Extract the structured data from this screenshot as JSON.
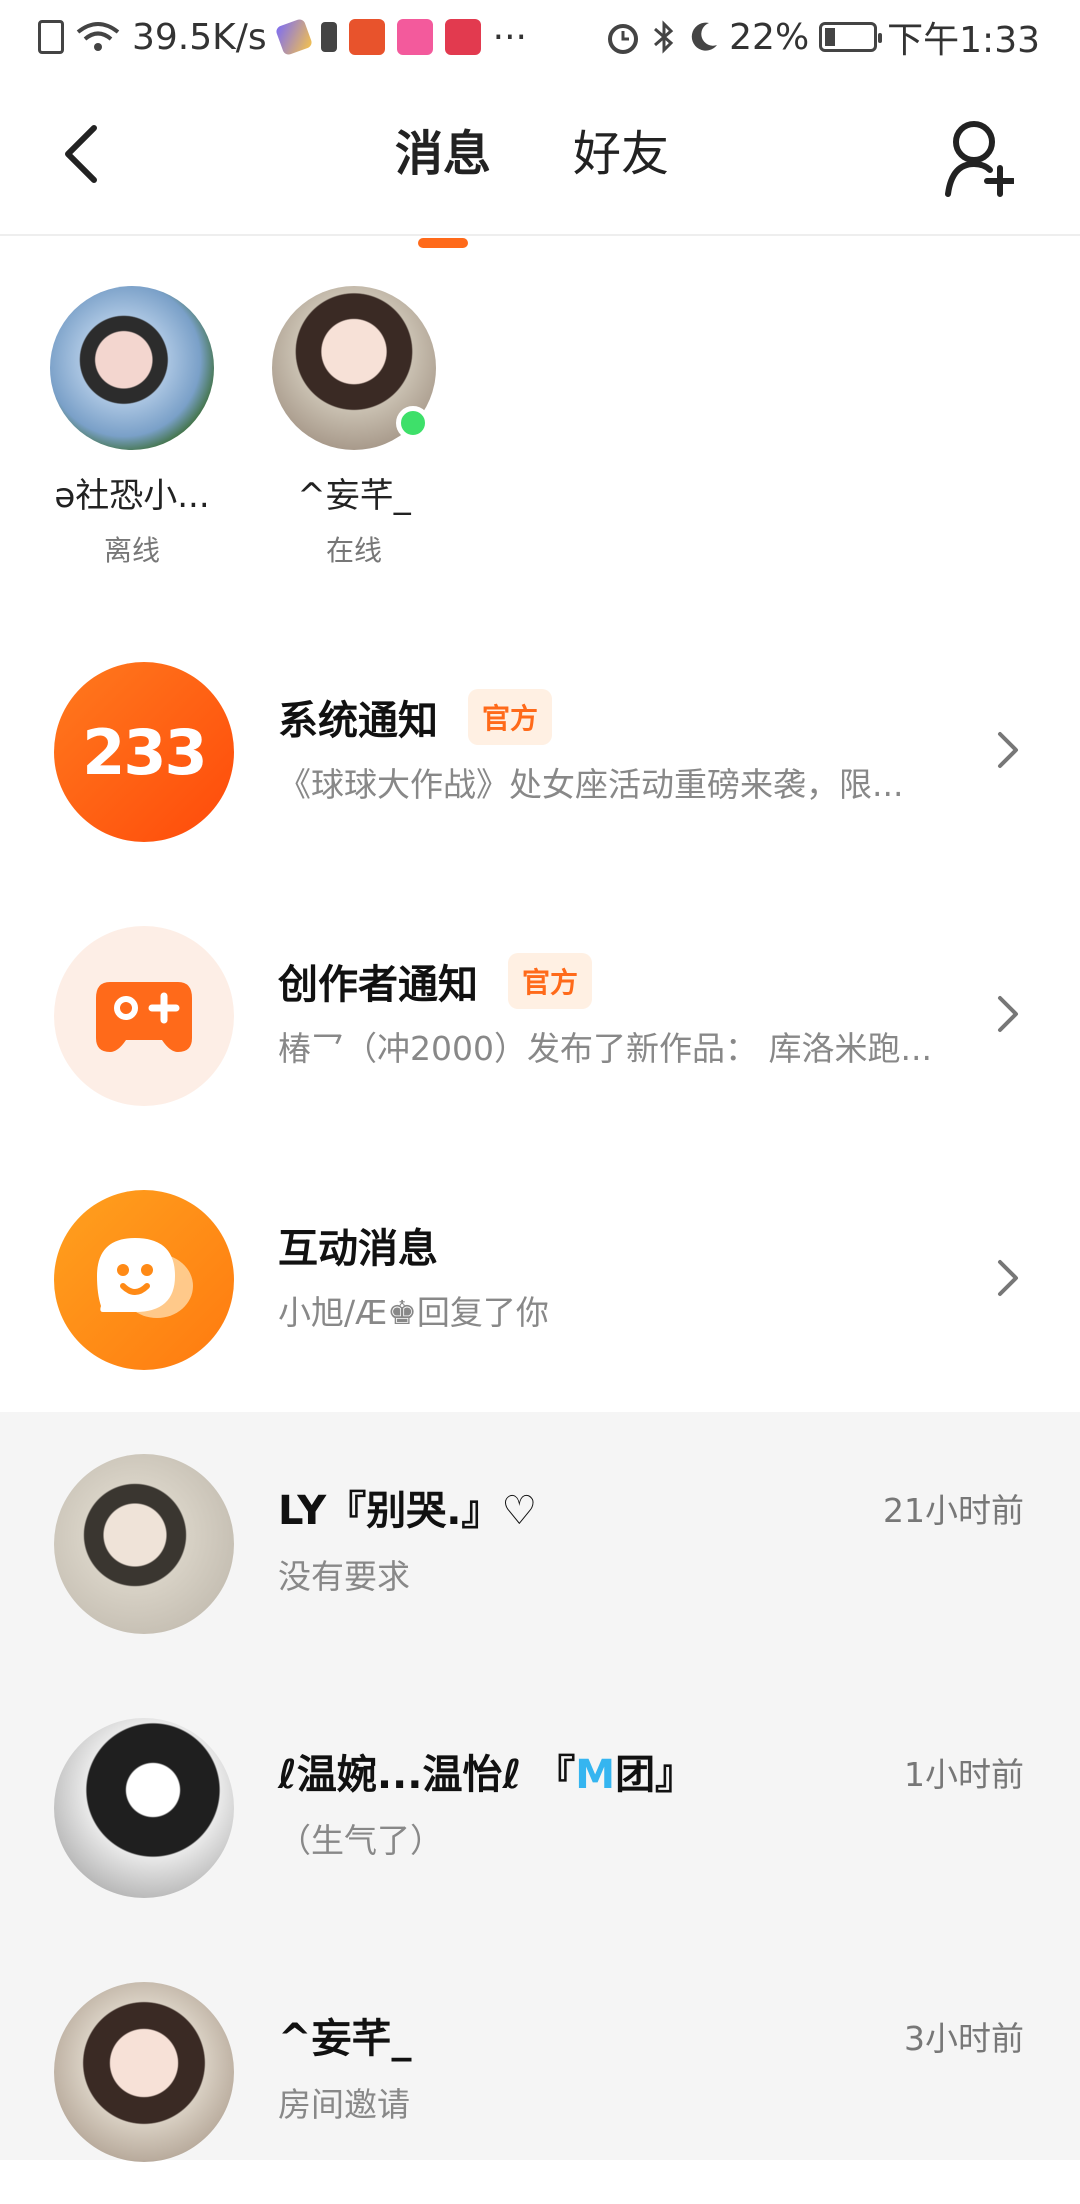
{
  "status_bar": {
    "net_speed": "39.5K/s",
    "battery": "22%",
    "time": "下午1:33",
    "more": "···"
  },
  "header": {
    "tabs": [
      "消息",
      "好友"
    ],
    "active_tab": "消息"
  },
  "friends": [
    {
      "name": "ə社恐小...",
      "status": "离线"
    },
    {
      "name": "^妄芊_",
      "status": "在线"
    }
  ],
  "notifications": [
    {
      "icon_text": "233",
      "title": "系统通知",
      "badge": "官方",
      "subtitle": "《球球大作战》处女座活动重磅来袭，限..."
    },
    {
      "title": "创作者通知",
      "badge": "官方",
      "subtitle": "椿乛（冲2000）发布了新作品：  库洛米跑..."
    },
    {
      "title": "互动消息",
      "subtitle": "小旭/Æ♚回复了你"
    }
  ],
  "chats": [
    {
      "name": "LY『别哭.』♡",
      "message": "没有要求",
      "time": "21小时前"
    },
    {
      "name_prefix": "ℓ温婉...温怡ℓ 『",
      "name_highlight": "M",
      "name_suffix": "团』",
      "message": "（生气了）",
      "time": "1小时前"
    },
    {
      "name": "^妄芊_",
      "message": "房间邀请",
      "time": "3小时前"
    }
  ],
  "colors": {
    "accent": "#ff6a1a",
    "badge_bg": "#fff0e3",
    "online": "#3ee06a",
    "m_blue": "#35b5f0"
  }
}
